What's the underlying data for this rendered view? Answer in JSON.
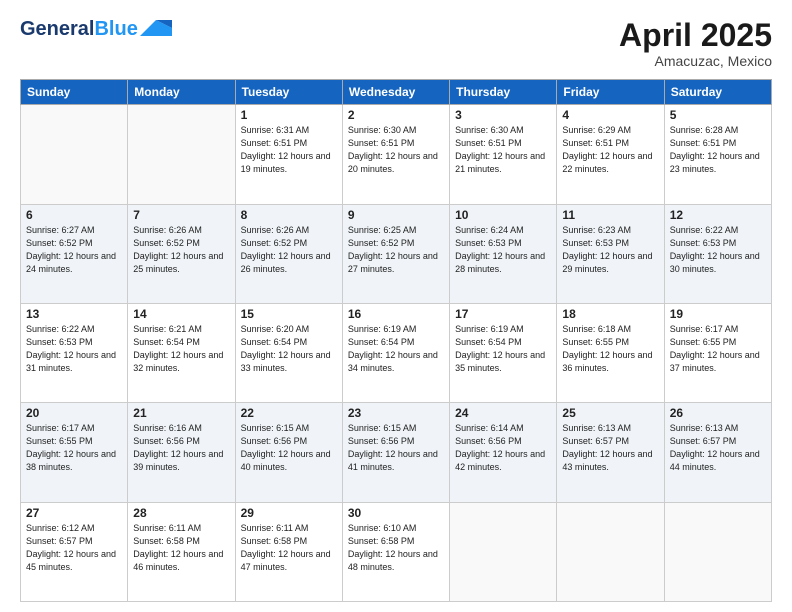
{
  "header": {
    "logo_line1": "General",
    "logo_line2": "Blue",
    "month": "April 2025",
    "location": "Amacuzac, Mexico"
  },
  "days_of_week": [
    "Sunday",
    "Monday",
    "Tuesday",
    "Wednesday",
    "Thursday",
    "Friday",
    "Saturday"
  ],
  "weeks": [
    [
      {
        "day": null
      },
      {
        "day": null
      },
      {
        "day": "1",
        "sunrise": "Sunrise: 6:31 AM",
        "sunset": "Sunset: 6:51 PM",
        "daylight": "Daylight: 12 hours and 19 minutes."
      },
      {
        "day": "2",
        "sunrise": "Sunrise: 6:30 AM",
        "sunset": "Sunset: 6:51 PM",
        "daylight": "Daylight: 12 hours and 20 minutes."
      },
      {
        "day": "3",
        "sunrise": "Sunrise: 6:30 AM",
        "sunset": "Sunset: 6:51 PM",
        "daylight": "Daylight: 12 hours and 21 minutes."
      },
      {
        "day": "4",
        "sunrise": "Sunrise: 6:29 AM",
        "sunset": "Sunset: 6:51 PM",
        "daylight": "Daylight: 12 hours and 22 minutes."
      },
      {
        "day": "5",
        "sunrise": "Sunrise: 6:28 AM",
        "sunset": "Sunset: 6:51 PM",
        "daylight": "Daylight: 12 hours and 23 minutes."
      }
    ],
    [
      {
        "day": "6",
        "sunrise": "Sunrise: 6:27 AM",
        "sunset": "Sunset: 6:52 PM",
        "daylight": "Daylight: 12 hours and 24 minutes."
      },
      {
        "day": "7",
        "sunrise": "Sunrise: 6:26 AM",
        "sunset": "Sunset: 6:52 PM",
        "daylight": "Daylight: 12 hours and 25 minutes."
      },
      {
        "day": "8",
        "sunrise": "Sunrise: 6:26 AM",
        "sunset": "Sunset: 6:52 PM",
        "daylight": "Daylight: 12 hours and 26 minutes."
      },
      {
        "day": "9",
        "sunrise": "Sunrise: 6:25 AM",
        "sunset": "Sunset: 6:52 PM",
        "daylight": "Daylight: 12 hours and 27 minutes."
      },
      {
        "day": "10",
        "sunrise": "Sunrise: 6:24 AM",
        "sunset": "Sunset: 6:53 PM",
        "daylight": "Daylight: 12 hours and 28 minutes."
      },
      {
        "day": "11",
        "sunrise": "Sunrise: 6:23 AM",
        "sunset": "Sunset: 6:53 PM",
        "daylight": "Daylight: 12 hours and 29 minutes."
      },
      {
        "day": "12",
        "sunrise": "Sunrise: 6:22 AM",
        "sunset": "Sunset: 6:53 PM",
        "daylight": "Daylight: 12 hours and 30 minutes."
      }
    ],
    [
      {
        "day": "13",
        "sunrise": "Sunrise: 6:22 AM",
        "sunset": "Sunset: 6:53 PM",
        "daylight": "Daylight: 12 hours and 31 minutes."
      },
      {
        "day": "14",
        "sunrise": "Sunrise: 6:21 AM",
        "sunset": "Sunset: 6:54 PM",
        "daylight": "Daylight: 12 hours and 32 minutes."
      },
      {
        "day": "15",
        "sunrise": "Sunrise: 6:20 AM",
        "sunset": "Sunset: 6:54 PM",
        "daylight": "Daylight: 12 hours and 33 minutes."
      },
      {
        "day": "16",
        "sunrise": "Sunrise: 6:19 AM",
        "sunset": "Sunset: 6:54 PM",
        "daylight": "Daylight: 12 hours and 34 minutes."
      },
      {
        "day": "17",
        "sunrise": "Sunrise: 6:19 AM",
        "sunset": "Sunset: 6:54 PM",
        "daylight": "Daylight: 12 hours and 35 minutes."
      },
      {
        "day": "18",
        "sunrise": "Sunrise: 6:18 AM",
        "sunset": "Sunset: 6:55 PM",
        "daylight": "Daylight: 12 hours and 36 minutes."
      },
      {
        "day": "19",
        "sunrise": "Sunrise: 6:17 AM",
        "sunset": "Sunset: 6:55 PM",
        "daylight": "Daylight: 12 hours and 37 minutes."
      }
    ],
    [
      {
        "day": "20",
        "sunrise": "Sunrise: 6:17 AM",
        "sunset": "Sunset: 6:55 PM",
        "daylight": "Daylight: 12 hours and 38 minutes."
      },
      {
        "day": "21",
        "sunrise": "Sunrise: 6:16 AM",
        "sunset": "Sunset: 6:56 PM",
        "daylight": "Daylight: 12 hours and 39 minutes."
      },
      {
        "day": "22",
        "sunrise": "Sunrise: 6:15 AM",
        "sunset": "Sunset: 6:56 PM",
        "daylight": "Daylight: 12 hours and 40 minutes."
      },
      {
        "day": "23",
        "sunrise": "Sunrise: 6:15 AM",
        "sunset": "Sunset: 6:56 PM",
        "daylight": "Daylight: 12 hours and 41 minutes."
      },
      {
        "day": "24",
        "sunrise": "Sunrise: 6:14 AM",
        "sunset": "Sunset: 6:56 PM",
        "daylight": "Daylight: 12 hours and 42 minutes."
      },
      {
        "day": "25",
        "sunrise": "Sunrise: 6:13 AM",
        "sunset": "Sunset: 6:57 PM",
        "daylight": "Daylight: 12 hours and 43 minutes."
      },
      {
        "day": "26",
        "sunrise": "Sunrise: 6:13 AM",
        "sunset": "Sunset: 6:57 PM",
        "daylight": "Daylight: 12 hours and 44 minutes."
      }
    ],
    [
      {
        "day": "27",
        "sunrise": "Sunrise: 6:12 AM",
        "sunset": "Sunset: 6:57 PM",
        "daylight": "Daylight: 12 hours and 45 minutes."
      },
      {
        "day": "28",
        "sunrise": "Sunrise: 6:11 AM",
        "sunset": "Sunset: 6:58 PM",
        "daylight": "Daylight: 12 hours and 46 minutes."
      },
      {
        "day": "29",
        "sunrise": "Sunrise: 6:11 AM",
        "sunset": "Sunset: 6:58 PM",
        "daylight": "Daylight: 12 hours and 47 minutes."
      },
      {
        "day": "30",
        "sunrise": "Sunrise: 6:10 AM",
        "sunset": "Sunset: 6:58 PM",
        "daylight": "Daylight: 12 hours and 48 minutes."
      },
      {
        "day": null
      },
      {
        "day": null
      },
      {
        "day": null
      }
    ]
  ]
}
